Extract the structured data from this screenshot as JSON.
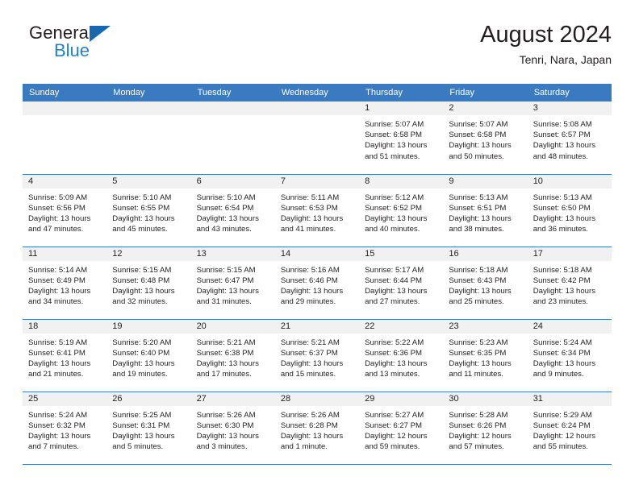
{
  "brand": {
    "name_top": "General",
    "name_bottom": "Blue",
    "accent_color": "#1d82d4",
    "triangle_color": "#1868b0"
  },
  "header": {
    "title": "August 2024",
    "subtitle": "Tenri, Nara, Japan"
  },
  "theme": {
    "header_row_bg": "#3a7ac0",
    "daynum_bg": "#f1f1f1",
    "row_divider": "#3a7ac0",
    "text": "#231f20"
  },
  "weekdays": [
    "Sunday",
    "Monday",
    "Tuesday",
    "Wednesday",
    "Thursday",
    "Friday",
    "Saturday"
  ],
  "weeks": [
    [
      {
        "empty": true
      },
      {
        "empty": true
      },
      {
        "empty": true
      },
      {
        "empty": true
      },
      {
        "day": "1",
        "sunrise": "Sunrise: 5:07 AM",
        "sunset": "Sunset: 6:58 PM",
        "daylight_1": "Daylight: 13 hours",
        "daylight_2": "and 51 minutes."
      },
      {
        "day": "2",
        "sunrise": "Sunrise: 5:07 AM",
        "sunset": "Sunset: 6:58 PM",
        "daylight_1": "Daylight: 13 hours",
        "daylight_2": "and 50 minutes."
      },
      {
        "day": "3",
        "sunrise": "Sunrise: 5:08 AM",
        "sunset": "Sunset: 6:57 PM",
        "daylight_1": "Daylight: 13 hours",
        "daylight_2": "and 48 minutes."
      }
    ],
    [
      {
        "day": "4",
        "sunrise": "Sunrise: 5:09 AM",
        "sunset": "Sunset: 6:56 PM",
        "daylight_1": "Daylight: 13 hours",
        "daylight_2": "and 47 minutes."
      },
      {
        "day": "5",
        "sunrise": "Sunrise: 5:10 AM",
        "sunset": "Sunset: 6:55 PM",
        "daylight_1": "Daylight: 13 hours",
        "daylight_2": "and 45 minutes."
      },
      {
        "day": "6",
        "sunrise": "Sunrise: 5:10 AM",
        "sunset": "Sunset: 6:54 PM",
        "daylight_1": "Daylight: 13 hours",
        "daylight_2": "and 43 minutes."
      },
      {
        "day": "7",
        "sunrise": "Sunrise: 5:11 AM",
        "sunset": "Sunset: 6:53 PM",
        "daylight_1": "Daylight: 13 hours",
        "daylight_2": "and 41 minutes."
      },
      {
        "day": "8",
        "sunrise": "Sunrise: 5:12 AM",
        "sunset": "Sunset: 6:52 PM",
        "daylight_1": "Daylight: 13 hours",
        "daylight_2": "and 40 minutes."
      },
      {
        "day": "9",
        "sunrise": "Sunrise: 5:13 AM",
        "sunset": "Sunset: 6:51 PM",
        "daylight_1": "Daylight: 13 hours",
        "daylight_2": "and 38 minutes."
      },
      {
        "day": "10",
        "sunrise": "Sunrise: 5:13 AM",
        "sunset": "Sunset: 6:50 PM",
        "daylight_1": "Daylight: 13 hours",
        "daylight_2": "and 36 minutes."
      }
    ],
    [
      {
        "day": "11",
        "sunrise": "Sunrise: 5:14 AM",
        "sunset": "Sunset: 6:49 PM",
        "daylight_1": "Daylight: 13 hours",
        "daylight_2": "and 34 minutes."
      },
      {
        "day": "12",
        "sunrise": "Sunrise: 5:15 AM",
        "sunset": "Sunset: 6:48 PM",
        "daylight_1": "Daylight: 13 hours",
        "daylight_2": "and 32 minutes."
      },
      {
        "day": "13",
        "sunrise": "Sunrise: 5:15 AM",
        "sunset": "Sunset: 6:47 PM",
        "daylight_1": "Daylight: 13 hours",
        "daylight_2": "and 31 minutes."
      },
      {
        "day": "14",
        "sunrise": "Sunrise: 5:16 AM",
        "sunset": "Sunset: 6:46 PM",
        "daylight_1": "Daylight: 13 hours",
        "daylight_2": "and 29 minutes."
      },
      {
        "day": "15",
        "sunrise": "Sunrise: 5:17 AM",
        "sunset": "Sunset: 6:44 PM",
        "daylight_1": "Daylight: 13 hours",
        "daylight_2": "and 27 minutes."
      },
      {
        "day": "16",
        "sunrise": "Sunrise: 5:18 AM",
        "sunset": "Sunset: 6:43 PM",
        "daylight_1": "Daylight: 13 hours",
        "daylight_2": "and 25 minutes."
      },
      {
        "day": "17",
        "sunrise": "Sunrise: 5:18 AM",
        "sunset": "Sunset: 6:42 PM",
        "daylight_1": "Daylight: 13 hours",
        "daylight_2": "and 23 minutes."
      }
    ],
    [
      {
        "day": "18",
        "sunrise": "Sunrise: 5:19 AM",
        "sunset": "Sunset: 6:41 PM",
        "daylight_1": "Daylight: 13 hours",
        "daylight_2": "and 21 minutes."
      },
      {
        "day": "19",
        "sunrise": "Sunrise: 5:20 AM",
        "sunset": "Sunset: 6:40 PM",
        "daylight_1": "Daylight: 13 hours",
        "daylight_2": "and 19 minutes."
      },
      {
        "day": "20",
        "sunrise": "Sunrise: 5:21 AM",
        "sunset": "Sunset: 6:38 PM",
        "daylight_1": "Daylight: 13 hours",
        "daylight_2": "and 17 minutes."
      },
      {
        "day": "21",
        "sunrise": "Sunrise: 5:21 AM",
        "sunset": "Sunset: 6:37 PM",
        "daylight_1": "Daylight: 13 hours",
        "daylight_2": "and 15 minutes."
      },
      {
        "day": "22",
        "sunrise": "Sunrise: 5:22 AM",
        "sunset": "Sunset: 6:36 PM",
        "daylight_1": "Daylight: 13 hours",
        "daylight_2": "and 13 minutes."
      },
      {
        "day": "23",
        "sunrise": "Sunrise: 5:23 AM",
        "sunset": "Sunset: 6:35 PM",
        "daylight_1": "Daylight: 13 hours",
        "daylight_2": "and 11 minutes."
      },
      {
        "day": "24",
        "sunrise": "Sunrise: 5:24 AM",
        "sunset": "Sunset: 6:34 PM",
        "daylight_1": "Daylight: 13 hours",
        "daylight_2": "and 9 minutes."
      }
    ],
    [
      {
        "day": "25",
        "sunrise": "Sunrise: 5:24 AM",
        "sunset": "Sunset: 6:32 PM",
        "daylight_1": "Daylight: 13 hours",
        "daylight_2": "and 7 minutes."
      },
      {
        "day": "26",
        "sunrise": "Sunrise: 5:25 AM",
        "sunset": "Sunset: 6:31 PM",
        "daylight_1": "Daylight: 13 hours",
        "daylight_2": "and 5 minutes."
      },
      {
        "day": "27",
        "sunrise": "Sunrise: 5:26 AM",
        "sunset": "Sunset: 6:30 PM",
        "daylight_1": "Daylight: 13 hours",
        "daylight_2": "and 3 minutes."
      },
      {
        "day": "28",
        "sunrise": "Sunrise: 5:26 AM",
        "sunset": "Sunset: 6:28 PM",
        "daylight_1": "Daylight: 13 hours",
        "daylight_2": "and 1 minute."
      },
      {
        "day": "29",
        "sunrise": "Sunrise: 5:27 AM",
        "sunset": "Sunset: 6:27 PM",
        "daylight_1": "Daylight: 12 hours",
        "daylight_2": "and 59 minutes."
      },
      {
        "day": "30",
        "sunrise": "Sunrise: 5:28 AM",
        "sunset": "Sunset: 6:26 PM",
        "daylight_1": "Daylight: 12 hours",
        "daylight_2": "and 57 minutes."
      },
      {
        "day": "31",
        "sunrise": "Sunrise: 5:29 AM",
        "sunset": "Sunset: 6:24 PM",
        "daylight_1": "Daylight: 12 hours",
        "daylight_2": "and 55 minutes."
      }
    ]
  ]
}
